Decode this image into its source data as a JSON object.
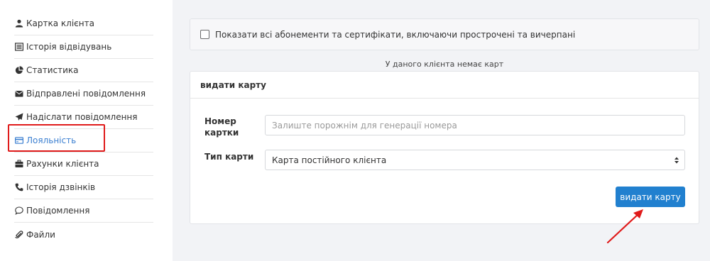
{
  "colors": {
    "accent": "#2180cf",
    "active_link": "#3b7fd1",
    "highlight": "#e01b1b",
    "main_bg": "#f2f3f6"
  },
  "sidebar": {
    "items": [
      {
        "label": "Картка клієнта",
        "icon": "user-icon"
      },
      {
        "label": "Історія відвідувань",
        "icon": "list-icon"
      },
      {
        "label": "Статистика",
        "icon": "pie-chart-icon"
      },
      {
        "label": "Відправлені повідомлення",
        "icon": "envelope-icon"
      },
      {
        "label": "Надіслати повідомлення",
        "icon": "paper-plane-icon"
      },
      {
        "label": "Лояльність",
        "icon": "credit-card-icon",
        "active": true
      },
      {
        "label": "Рахунки клієнта",
        "icon": "briefcase-icon"
      },
      {
        "label": "Історія дзвінків",
        "icon": "phone-icon"
      },
      {
        "label": "Повідомлення",
        "icon": "comment-icon"
      },
      {
        "label": "Файли",
        "icon": "paperclip-icon"
      }
    ]
  },
  "filter": {
    "checkbox_label": "Показати всі абонементи та сертифікати, включаючи прострочені та вичерпані",
    "checked": false
  },
  "no_cards_text": "У даного клієнта немає карт",
  "issue_panel": {
    "title": "видати карту",
    "card_number_label_line1": "Номер",
    "card_number_label_line2": "картки",
    "card_number_placeholder": "Залиште порожнім для генерації номера",
    "card_number_value": "",
    "card_type_label": "Тип карти",
    "card_type_selected": "Карта постійного клієнта",
    "submit_label": "видати карту"
  }
}
